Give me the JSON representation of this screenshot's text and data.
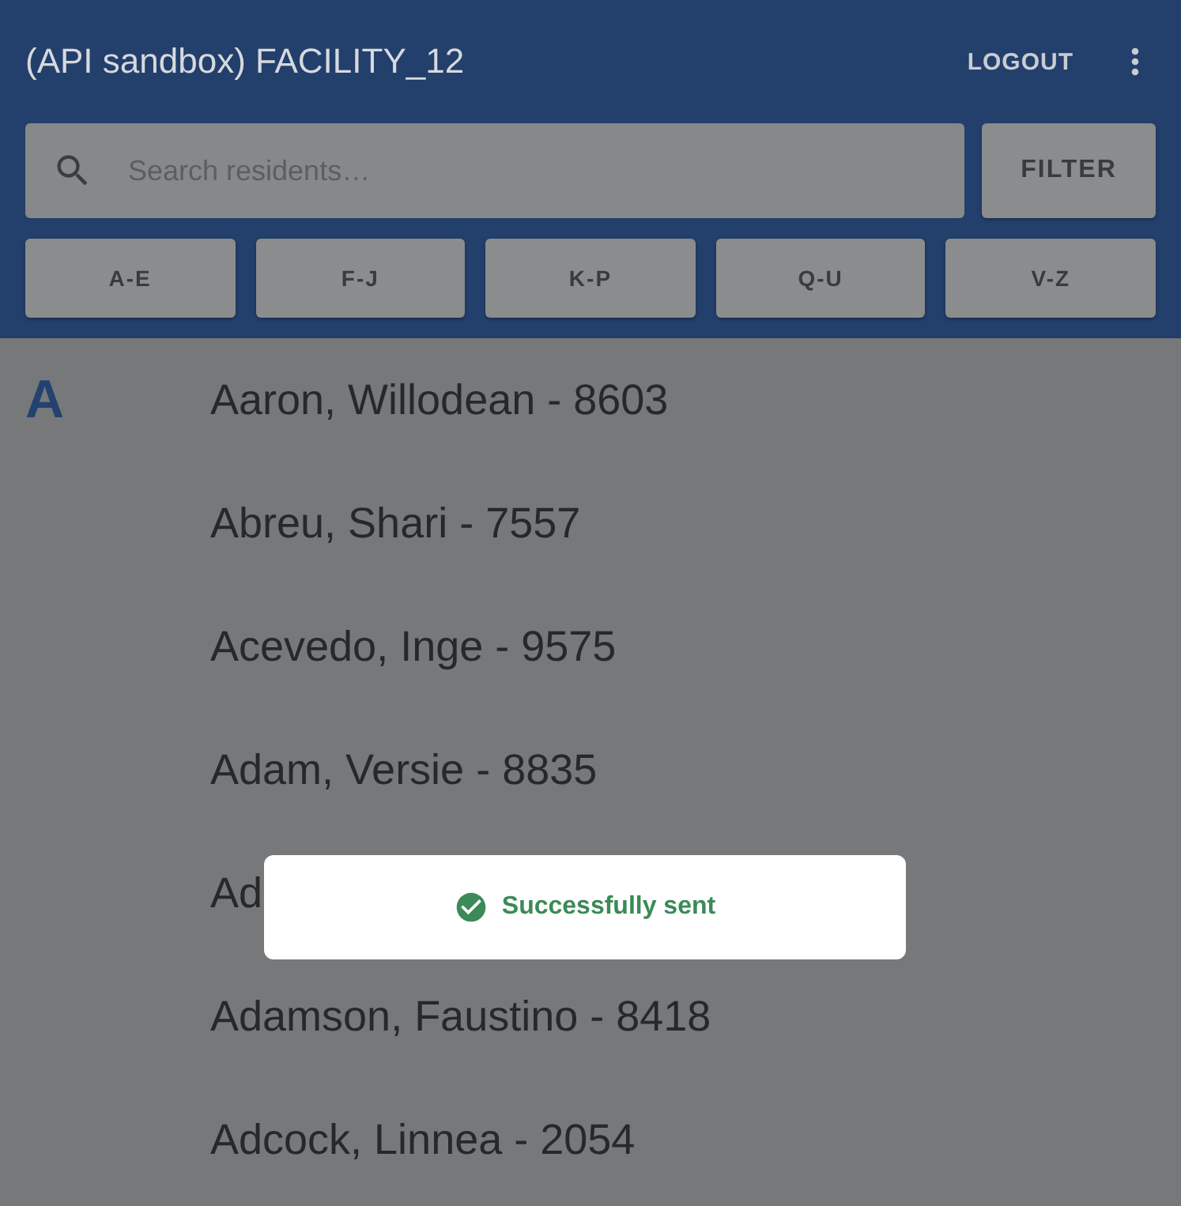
{
  "header": {
    "title": "(API sandbox) FACILITY_12",
    "logout": "LOGOUT"
  },
  "search": {
    "placeholder": "Search residents…"
  },
  "filter_button": "FILTER",
  "alpha_tabs": [
    {
      "label": "A-E"
    },
    {
      "label": "F-J"
    },
    {
      "label": "K-P"
    },
    {
      "label": "Q-U"
    },
    {
      "label": "V-Z"
    }
  ],
  "sections": [
    {
      "letter": "A",
      "residents": [
        "Aaron, Willodean - 8603",
        "Abreu, Shari - 7557",
        "Acevedo, Inge - 9575",
        "Adam, Versie - 8835",
        "Ad",
        "Adamson, Faustino - 8418",
        "Adcock, Linnea - 2054"
      ]
    }
  ],
  "toast": {
    "kind": "success",
    "message": "Successfully sent"
  }
}
